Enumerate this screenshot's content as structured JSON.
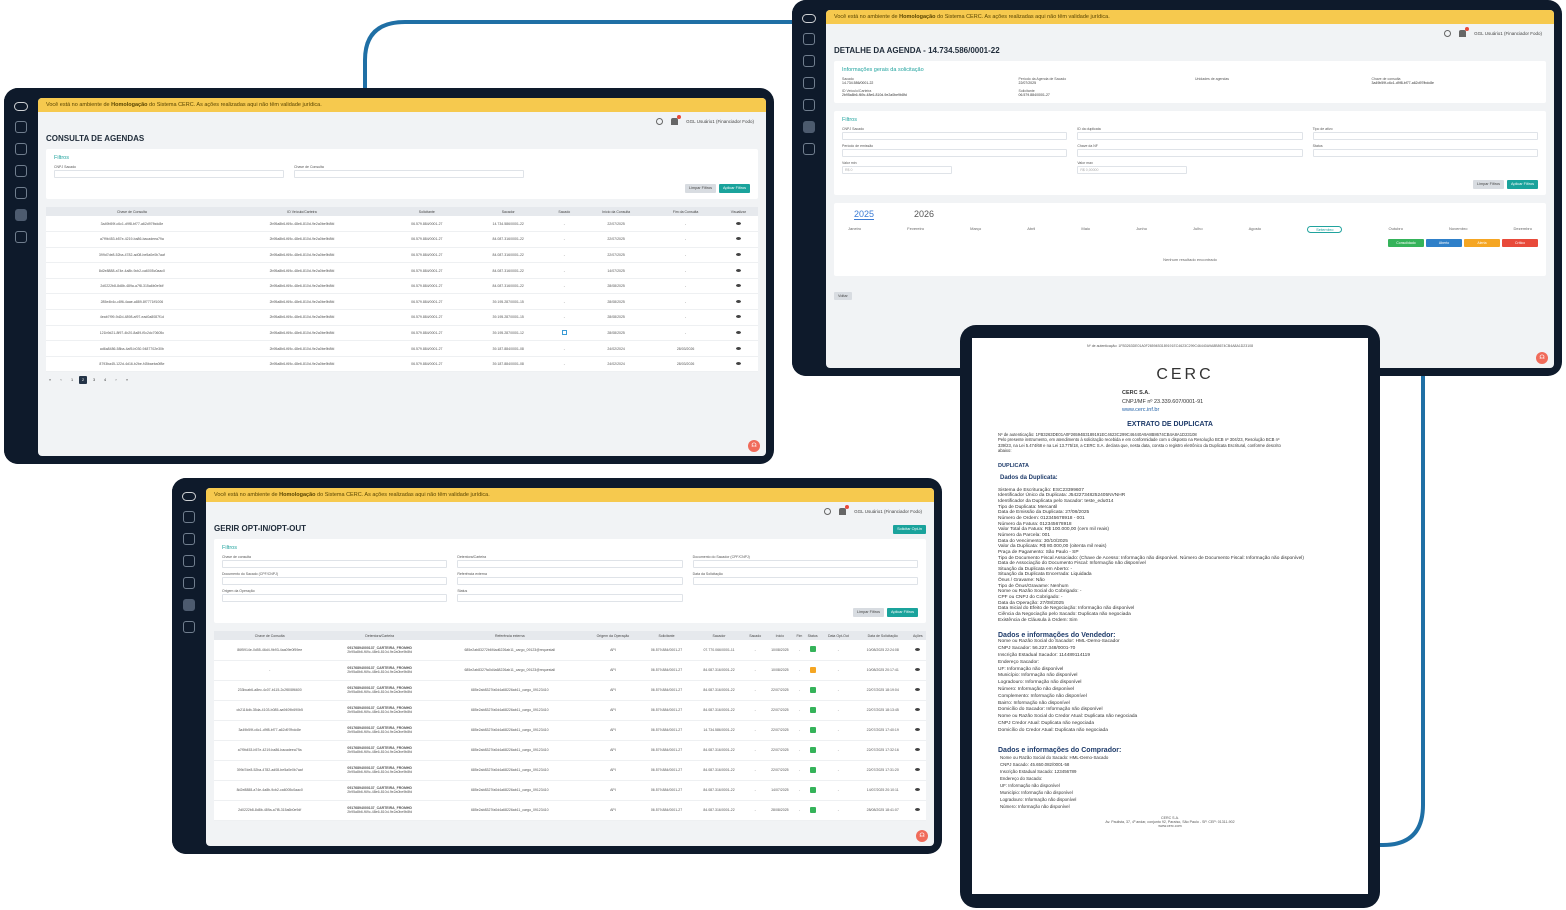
{
  "banner": {
    "prefix": "Você está no ambiente de ",
    "env": "Homologação",
    "suffix": " do Sistema CERC. As ações realizadas aqui não têm validade jurídica."
  },
  "user_menu": "GGL Usuário1 (Financiador Fodo)",
  "consulta": {
    "title": "CONSULTA DE AGENDAS",
    "filters_title": "Filtros",
    "fields": [
      "CNPJ Sacado",
      "Chave de Consulta"
    ],
    "btn_clear": "Limpar Filtros",
    "btn_apply": "Aplicar Filtros",
    "columns": [
      "Chave de Consulta",
      "ID Veículo/Carteira",
      "Solicitante",
      "Sacador",
      "Sacado",
      "Início da Consulta",
      "Fim da Consulta",
      "Visualizar"
    ],
    "rows": [
      [
        "3a49b59f-c6c1-d9f8-bf77-a62d97fbdc8e",
        "2b95a8b6-f69c-48e6-810d-9e2a0be9b8fd",
        "06.579.884/0001-27",
        "14.734.586/0001-22",
        "-",
        "22/07/2025",
        "-"
      ],
      [
        "a7f9b453-b57e-4219-ba86-bacadeea79a",
        "2b95a8b6-f69c-48e6-810d-9e2a0be9b8fd",
        "06.579.884/0001-27",
        "84.087.316/0001-22",
        "-",
        "22/07/2025",
        "-"
      ],
      [
        "399d7de8-52ba-4782-ad08-be5a0e0b7aaf",
        "2b95a8b6-f69c-48e6-810d-9e2a0be9b8fd",
        "06.579.884/0001-27",
        "84.087.316/0001-22",
        "-",
        "22/07/2025",
        "-"
      ],
      [
        "8d2e8888-a74e-4a8b-9cb2-ca6005c0aac0",
        "2b95a8b6-f69c-48e6-810d-9e2a0be9b8fd",
        "06.579.884/0001-27",
        "84.087.316/0001-22",
        "-",
        "14/07/2025",
        "-"
      ],
      [
        "2d0222b8-8d8b-489a-a7f8-315a6b0e9df",
        "2b95a8b6-f69c-48e6-810d-9e2a0be9b8fd",
        "06.579.884/0001-27",
        "84.087.316/0001-22",
        "-",
        "28/08/2025",
        "-"
      ],
      [
        "285e4b4c-c8f6-4aae-a889-8f7771ff1006",
        "2b95a8b6-f69c-48e6-810d-9e2a0be9b8fd",
        "06.579.884/0001-27",
        "39.195.287/0001-15",
        "-",
        "28/08/2025",
        "-"
      ],
      [
        "4eab7f99-9d2d-4898-af97-ead0a8087f1d",
        "2b95a8b6-f69c-48e6-810d-9e2a0be9b8fd",
        "06.579.884/0001-27",
        "39.195.287/0001-15",
        "-",
        "28/08/2025",
        "-"
      ],
      [
        "121b9d21-8f97-4b20-8a89-f0c2dc70605c",
        "2b95a8b6-f69c-48e6-810d-9e2a0be9b8fd",
        "06.579.884/0001-27",
        "39.195.287/0001-12",
        "ext",
        "28/08/2025",
        "-"
      ],
      [
        "ad6a8486-58ba-4af5-b030-9487702e30b",
        "2b95a8b6-f69c-48e6-810d-9e2a0be9b8fd",
        "06.579.884/0001-27",
        "39.187.884/0001-08",
        "-",
        "24/02/2024",
        "28/03/2026"
      ],
      [
        "8793ba45-122d-4d16-b2be-f45baeba0f8e",
        "2b95a8b6-f69c-48e6-810d-9e2a0be9b8fd",
        "06.579.884/0001-27",
        "39.187.884/0001-08",
        "-",
        "24/02/2024",
        "28/03/2026"
      ]
    ],
    "pages": [
      "«",
      "‹",
      "1",
      "2",
      "3",
      "4",
      "›",
      "»"
    ]
  },
  "detalhe": {
    "title": "DETALHE DA AGENDA - 14.734.586/0001-22",
    "info_title": "Informações gerais da solicitação",
    "info": [
      {
        "label": "Sacado",
        "value": "14.734.586/0001-22"
      },
      {
        "label": "Período da Agenda de Sacado",
        "value": "22/07/2025"
      },
      {
        "label": "Unidades de agendas",
        "value": ""
      },
      {
        "label": "Chave de consulta",
        "value": "3a49b59f-c6c1-d9f8-bf77-a62d97fbdc8e"
      },
      {
        "label": "ID Veículo/Carteira",
        "value": "2b95a8b6-f69c-48e6-810d-9e2a0be9b8fd"
      },
      {
        "label": "Solicitante",
        "value": "06.579.884/0001-27"
      }
    ],
    "filters_title": "Filtros",
    "fields": [
      "CNPJ Sacado",
      "ID da duplicata",
      "Tipo de ativo",
      "Período de emissão",
      "Chave da NF",
      "Status",
      "Valor min",
      "Valor max"
    ],
    "value_placeholders": [
      "R$ 0",
      "R$ 0,00000"
    ],
    "btn_clear": "Limpar Filtros",
    "btn_apply": "Aplicar Filtros",
    "years": [
      "2025",
      "2026"
    ],
    "months": [
      "Janeiro",
      "Fevereiro",
      "Março",
      "Abril",
      "Maio",
      "Junho",
      "Julho",
      "Agosto",
      "Setembro",
      "Outubro",
      "Novembro",
      "Dezembro"
    ],
    "legend": [
      {
        "label": "Consolidado",
        "color": "#35b35a"
      },
      {
        "label": "Aberto",
        "color": "#2f80c9"
      },
      {
        "label": "Alerta",
        "color": "#f5a623"
      },
      {
        "label": "Crítico",
        "color": "#e84a3a"
      }
    ],
    "empty": "Nenhum resultado encontrado",
    "btn_back": "Voltar"
  },
  "optin": {
    "title": "GERIR OPT-IN/OPT-OUT",
    "btn_request": "Solicitar Opt-in",
    "filters_title": "Filtros",
    "fields": [
      "Chave de consulta",
      "Detentora/Carteira",
      "Documento do Sacador (CPF/CNPJ)",
      "Documento do Sacado (CPF/CNPJ)",
      "Referência externa",
      "Data da Solicitação",
      "Origem da Operação",
      "Status"
    ],
    "btn_clear": "Limpar Filtros",
    "btn_apply": "Aplicar Filtros",
    "columns": [
      "Chave de Consulta",
      "Detentora/Carteira",
      "Referência externa",
      "Origem da Operação",
      "Solicitante",
      "Sacador",
      "Sacado",
      "Início",
      "Fim",
      "Status",
      "Data Opt-Out",
      "Data de Solicitação",
      "Ações"
    ],
    "rows": [
      [
        "86f5914e-0d55-46d4-9b93-4aa09e0f59ee",
        "09176894000137_CARTEIRA_FROMHD",
        "2b95a8b6-f69c-48e6-810d-9e2a0be9b8fd",
        "685e2ab83272b6f4ad6226ab11_cargo_09123@requestall",
        "API",
        "06.579.884/0001-27",
        "07.770.066/0001-11",
        "-",
        "10/08/2025",
        "-",
        "ok",
        "-",
        "10/08/2025 22:24:08"
      ],
      [
        "-",
        "09176894000137_CARTEIRA_FROMHD",
        "2b95a8b6-f69c-48e6-810d-9e2a0be9b8fd",
        "685e2ab8327fa0d4a68226ab11_cargo_09123@requestall",
        "API",
        "06.579.884/0001-27",
        "84.087.316/0001-22",
        "-",
        "10/08/2025",
        "-",
        "wait",
        "-",
        "10/08/2025 20:17:41"
      ],
      [
        "233bcab6-a8ec-4c07-b115-2c2f808f6600",
        "09176894000137_CARTEIRA_FROMHD",
        "2b95a8b6-f69c-48e6-810d-9e2a0be9b8fd",
        "685e2ab8327fa0d4a68226ab11_cargo_09123410",
        "API",
        "06.579.884/0001-27",
        "84.087.316/0001-22",
        "-",
        "22/07/2025",
        "-",
        "ok",
        "-",
        "22/07/2025 18:19:04"
      ],
      [
        "cb2116db-35da-4103-b085-aa9409b690b5",
        "09176894000137_CARTEIRA_FROMHD",
        "2b95a8b6-f69c-48e6-810d-9e2a0be9b8fd",
        "685e2ab8327fa0d4a68226ab11_cargo_09123410",
        "API",
        "06.579.884/0001-27",
        "84.087.316/0001-22",
        "-",
        "22/07/2025",
        "-",
        "ok",
        "-",
        "22/07/2025 18:13:45"
      ],
      [
        "3a49b59f-c6c1-d9f8-bf77-a62d97fbdc8e",
        "09176894000137_CARTEIRA_FROMHD",
        "2b95a8b6-f69c-48e6-810d-9e2a0be9b8fd",
        "685e2ab8327fa0d4a68226ab11_cargo_09123410",
        "API",
        "06.579.884/0001-27",
        "14.734.586/0001-22",
        "-",
        "22/07/2025",
        "-",
        "ok",
        "-",
        "22/07/2025 17:40:19"
      ],
      [
        "a7f9b453-b57e-4219-ba86-bacadeea79a",
        "09176894000137_CARTEIRA_FROMHD",
        "2b95a8b6-f69c-48e6-810d-9e2a0be9b8fd",
        "685e2ab8327fa0d4a68226ab11_cargo_09123410",
        "API",
        "06.579.884/0001-27",
        "84.087.316/0001-22",
        "-",
        "22/07/2025",
        "-",
        "ok",
        "-",
        "22/07/2025 17:32:16"
      ],
      [
        "399d7de8-52ba-4782-ad08-be5a0e0b7aaf",
        "09176894000137_CARTEIRA_FROMHD",
        "2b95a8b6-f69c-48e6-810d-9e2a0be9b8fd",
        "685e2ab8327fa0d4a68226ab11_cargo_09123410",
        "API",
        "06.579.884/0001-27",
        "84.087.316/0001-22",
        "-",
        "22/07/2025",
        "-",
        "ok",
        "-",
        "22/07/2025 17:31:20"
      ],
      [
        "8d2e8888-a74e-4a8b-9cb2-ca6005c0aac0",
        "09176894000137_CARTEIRA_FROMHD",
        "2b95a8b6-f69c-48e6-810d-9e2a0be9b8fd",
        "685e2ab8327fa0d4a68226ab11_cargo_09123410",
        "API",
        "06.579.884/0001-27",
        "84.087.316/0001-22",
        "-",
        "14/07/2025",
        "-",
        "ok",
        "-",
        "14/07/2025 20:10:11"
      ],
      [
        "2d0222b8-8d8b-489a-a7f8-315a6b0e9df",
        "09176894000137_CARTEIRA_FROMHD",
        "2b95a8b6-f69c-48e6-810d-9e2a0be9b8fd",
        "685e2ab8327fa0d4a68226ab11_cargo_09123410",
        "API",
        "06.579.884/0001-27",
        "84.087.316/0001-22",
        "-",
        "28/08/2025",
        "-",
        "ok",
        "-",
        "28/08/2025 18:41:07"
      ]
    ]
  },
  "doc": {
    "auth_header": "Nº de autenticação: 1FB3263DE01A0F26594B3189191EC4623C299C46440A9A8B8674CB4A8A1D23108",
    "logo": "CERC",
    "company": "CERC S.A.",
    "cnpj": "CNPJ/MF nº 23.339.607/0001-91",
    "site": "www.cerc.inf.br",
    "heading": "EXTRATO DE DUPLICATA",
    "intro": [
      "Nº de autenticação: 1FB3263DE01A0F26594B3189191EC4623C299C46440A9A8B8674CB4A8A1D23108",
      "Pelo presente instrumento, em atendimento à solicitação recebida e em conformidade com o disposto na Resolução BCB nº 304/23, Resolução BCB nº",
      "339/23, na Lei 5.474/68 e na Lei 13.775/18, a CERC S.A. declara que, nesta data, consta o registro eletrônico da Duplicata Escritural, conforme descrito",
      "abaixo:"
    ],
    "duplicata_label": "DUPLICATA",
    "dados_duplicata": "Dados da Duplicata:",
    "duplicata_lines": [
      "Sistema de Escrituração: ESC23399607",
      "Identificador Único da Duplicata: J54227348252405NVNHR",
      "Identificador da Duplicata pelo Sacador: teste_edu014",
      "Tipo de Duplicata: Mercantil",
      "Data de Emissão da Duplicata: 27/08/2025",
      "Número de Ordem: 012345678918 - 001",
      "Número da Fatura: 012345678918",
      "Valor Total da Fatura: R$ 100.000,00 (cem mil reais)",
      "Número da Parcela: 001",
      "Data do Vencimento: 30/10/2025",
      "Valor da Duplicata: R$ 80.000,00 (oitenta mil reais)",
      "Praça de Pagamento: São Paulo - SP",
      "Tipo de Documento Fiscal Associado: (Chave de Acesso: Informação não disponível. Número de Documento Fiscal: Informação não disponível)",
      "Data de Associação do Documento Fiscal: Informação não disponível",
      "Situação da Duplicata em Aberto: -",
      "Situação da Duplicata Encerrada: Liquidada",
      "Ônus / Gravame: Não",
      "Tipo de Ônus/Gravame: Nenhum",
      "Nome ou Razão Social do Cobrigado: -",
      "CPF ou CNPJ do Cobrigado: -",
      "Data da Operação: 27/08/2025",
      "Data Inicial do Efeito de Negociação: Informação não disponível",
      "Ciência da Negociação pelo Sacado: Duplicata não negociada",
      "Existência de Cláusula à Ordem: Sim"
    ],
    "vendedor_title": "Dados e informações do Vendedor:",
    "vendedor_lines": [
      "Nome ou Razão Social do Sacador: HML-Demo-Sacador",
      "CNPJ Sacador: 56.227.348/0001-70",
      "Inscrição Estadual Sacador: 114489114119",
      "Endereço Sacador:",
      "UF: Informação não disponível",
      "Município: Informação não disponível",
      "Logradouro: Informação não disponível",
      "Número: Informação não disponível",
      "Complemento: Informação não disponível",
      "Bairro: Informação não disponível",
      "Domicílio do Sacador: Informação não disponível",
      "Nome ou Razão Social do Credor Atual: Duplicata não negociada",
      "CNPJ Credor Atual: Duplicata não negociada",
      "Domicílio do Credor Atual: Duplicata não negociada"
    ],
    "comprador_title": "Dados e informações do Comprador:",
    "comprador_lines": [
      "Nome ou Razão Social do Sacado: HML-Demo-Sacado",
      "CNPJ Sacado: 45.650.082/0001-58",
      "Inscrição Estadual Sacado: 123456789",
      "Endereço do Sacado:",
      "UF: Informação não disponível",
      "Município: Informação não disponível",
      "Logradouro: Informação não disponível",
      "Número: Informação não disponível"
    ],
    "footer": [
      "CERC S.A.",
      "Av. Paulista, 37, 4º andar, conjunto 92, Paraíso, São Paulo - SP. CEP: 01311-902",
      "www.cerc.com"
    ]
  },
  "colors": {
    "accent": "#20a39e",
    "banner": "#f6c94e",
    "frame": "#0e1a2b",
    "connector": "#1f6fa5"
  }
}
